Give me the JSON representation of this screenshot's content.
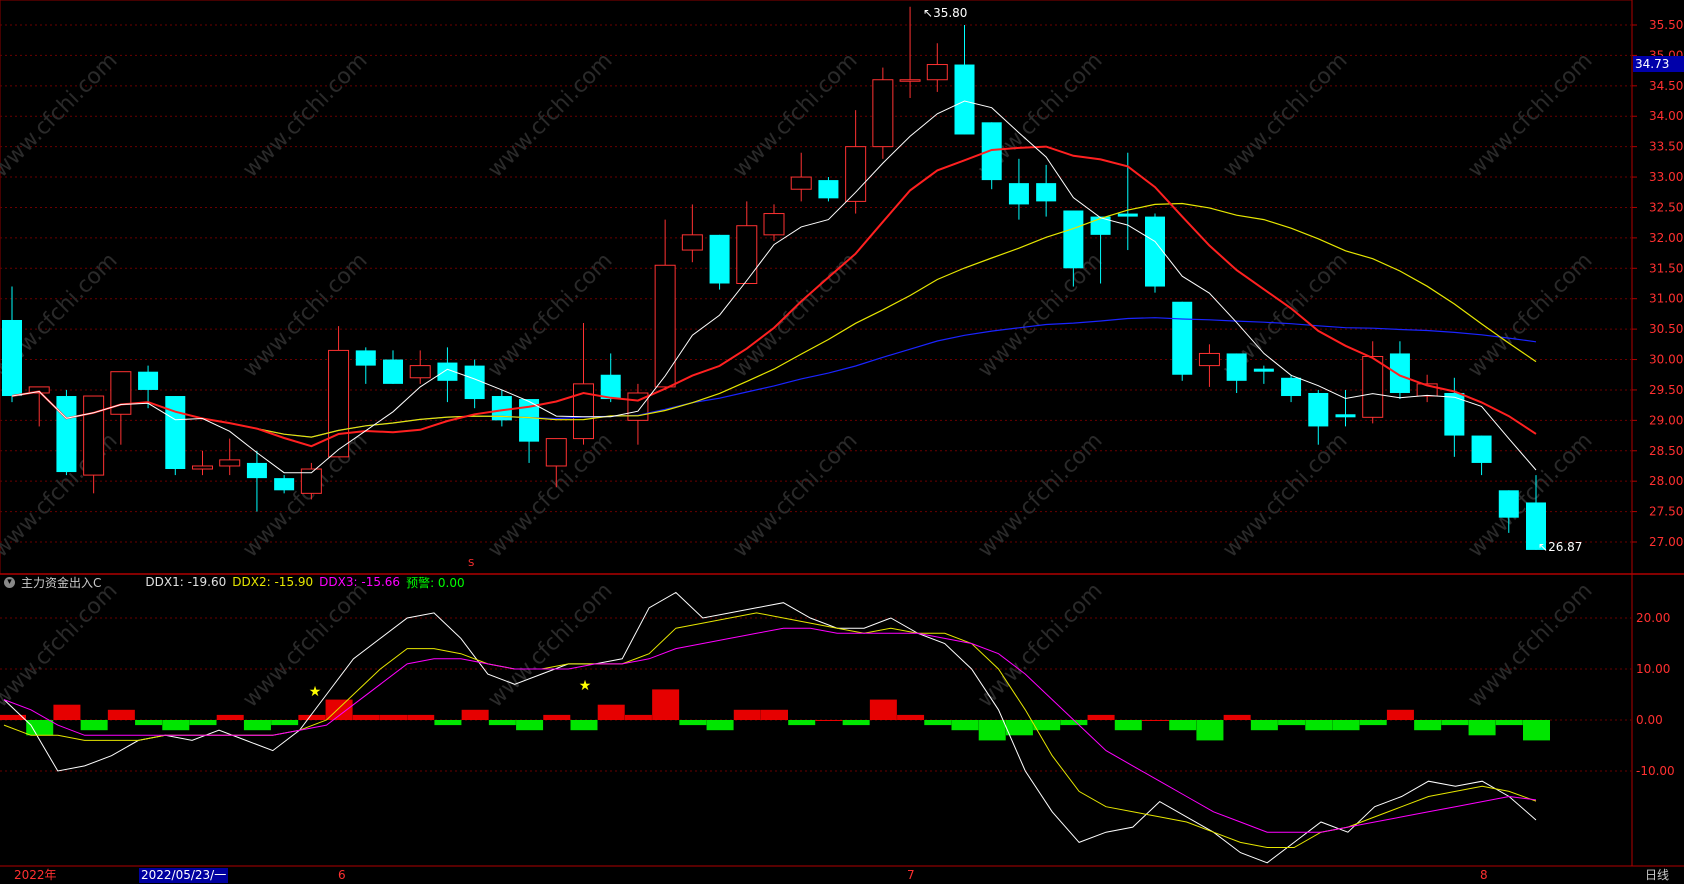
{
  "main_chart": {
    "price_ticks": [
      "35.50",
      "35.00",
      "34.50",
      "34.00",
      "33.50",
      "33.00",
      "32.50",
      "32.00",
      "31.50",
      "31.00",
      "30.50",
      "30.00",
      "29.50",
      "29.00",
      "28.50",
      "28.00",
      "27.50",
      "27.00"
    ],
    "current_price": "34.73",
    "high_label": "35.80",
    "low_label": "26.87",
    "dividend_mark": "S",
    "colors": {
      "up": "#ff3232",
      "down": "#00ffff",
      "ma5": "#ffffff",
      "ma10": "#ff2020",
      "ma20": "#e6e600",
      "ma60": "#1a24ff",
      "grid": "#8b0000"
    }
  },
  "indicator": {
    "name": "主力资金出入C",
    "ddx1_label": "DDX1: -19.60",
    "ddx2_label": "DDX2: -15.90",
    "ddx3_label": "DDX3: -15.66",
    "warn_label": "预警: 0.00",
    "y_ticks": [
      "20.00",
      "10.00",
      "0.00",
      "-10.00"
    ],
    "colors": {
      "ddx1": "#ffffff",
      "ddx2": "#e6e600",
      "ddx3": "#ff00ff",
      "warn": "#00ff00",
      "bar_pos": "#ff0000",
      "bar_neg": "#00ff00"
    }
  },
  "time_axis": {
    "year": "2022年",
    "cursor_date": "2022/05/23/一",
    "month_6": "6",
    "month_7": "7",
    "month_8": "8",
    "period": "日线"
  },
  "watermark": "www.cfchi.com",
  "chart_data": [
    {
      "type": "candlestick",
      "title": "",
      "ylim": [
        26.6,
        35.9
      ],
      "x": [
        "d1",
        "d2",
        "d3",
        "d4",
        "d5",
        "d6",
        "d7",
        "d8",
        "d9",
        "d10",
        "d11",
        "d12",
        "d13",
        "d14",
        "d15",
        "d16",
        "d17",
        "d18",
        "d19",
        "d20",
        "d21",
        "d22",
        "d23",
        "d24",
        "d25",
        "d26",
        "d27",
        "d28",
        "d29",
        "d30",
        "d31",
        "d32",
        "d33",
        "d34",
        "d35",
        "d36",
        "d37",
        "d38",
        "d39",
        "d40",
        "d41",
        "d42",
        "d43",
        "d44",
        "d45",
        "d46",
        "d47",
        "d48",
        "d49",
        "d50",
        "d51",
        "d52",
        "d53",
        "d54",
        "d55",
        "d56"
      ],
      "candles": [
        [
          30.65,
          31.2,
          29.3,
          29.4
        ],
        [
          29.45,
          29.55,
          28.9,
          29.55
        ],
        [
          29.4,
          29.5,
          28.1,
          28.15
        ],
        [
          28.1,
          29.4,
          27.8,
          29.4
        ],
        [
          29.1,
          29.8,
          28.6,
          29.8
        ],
        [
          29.8,
          29.9,
          29.2,
          29.5
        ],
        [
          29.4,
          29.4,
          28.1,
          28.2
        ],
        [
          28.2,
          28.5,
          28.1,
          28.25
        ],
        [
          28.25,
          28.7,
          28.1,
          28.35
        ],
        [
          28.3,
          28.5,
          27.5,
          28.05
        ],
        [
          28.05,
          28.1,
          27.8,
          27.85
        ],
        [
          27.8,
          28.3,
          27.7,
          28.2
        ],
        [
          28.4,
          30.55,
          28.4,
          30.15
        ],
        [
          30.15,
          30.2,
          29.6,
          29.9
        ],
        [
          30.0,
          30.15,
          29.6,
          29.6
        ],
        [
          29.7,
          30.15,
          29.6,
          29.9
        ],
        [
          29.95,
          30.2,
          29.3,
          29.65
        ],
        [
          29.9,
          30.0,
          29.2,
          29.35
        ],
        [
          29.4,
          29.5,
          28.9,
          29.0
        ],
        [
          29.35,
          29.35,
          28.3,
          28.65
        ],
        [
          28.25,
          28.7,
          27.9,
          28.7
        ],
        [
          28.7,
          30.6,
          28.6,
          29.6
        ],
        [
          29.75,
          30.1,
          29.3,
          29.35
        ],
        [
          29.0,
          29.6,
          28.6,
          29.45
        ],
        [
          29.55,
          32.3,
          29.5,
          31.55
        ],
        [
          31.8,
          32.55,
          31.6,
          32.05
        ],
        [
          32.05,
          32.05,
          31.15,
          31.25
        ],
        [
          31.25,
          32.6,
          31.25,
          32.2
        ],
        [
          32.05,
          32.55,
          31.95,
          32.4
        ],
        [
          32.8,
          33.4,
          32.6,
          33.0
        ],
        [
          32.95,
          33.0,
          32.6,
          32.65
        ],
        [
          32.6,
          34.1,
          32.4,
          33.5
        ],
        [
          33.5,
          34.8,
          33.3,
          34.6
        ],
        [
          34.6,
          35.8,
          34.3,
          34.6
        ],
        [
          34.6,
          35.2,
          34.4,
          34.85
        ],
        [
          34.85,
          35.5,
          33.7,
          33.7
        ],
        [
          33.9,
          33.9,
          32.8,
          32.95
        ],
        [
          32.9,
          33.3,
          32.3,
          32.55
        ],
        [
          32.9,
          33.2,
          32.35,
          32.6
        ],
        [
          32.45,
          32.45,
          31.2,
          31.5
        ],
        [
          32.35,
          32.35,
          31.25,
          32.05
        ],
        [
          32.4,
          33.4,
          31.8,
          32.35
        ],
        [
          32.35,
          32.4,
          31.1,
          31.2
        ],
        [
          30.95,
          30.95,
          29.65,
          29.75
        ],
        [
          29.9,
          30.25,
          29.55,
          30.1
        ],
        [
          30.1,
          30.1,
          29.45,
          29.65
        ],
        [
          29.85,
          29.9,
          29.6,
          29.8
        ],
        [
          29.7,
          29.75,
          29.3,
          29.4
        ],
        [
          29.45,
          29.5,
          28.6,
          28.9
        ],
        [
          29.1,
          29.5,
          28.9,
          29.05
        ],
        [
          29.05,
          30.3,
          28.95,
          30.05
        ],
        [
          30.1,
          30.3,
          29.35,
          29.45
        ],
        [
          29.4,
          29.75,
          29.3,
          29.6
        ],
        [
          29.45,
          29.7,
          28.4,
          28.75
        ],
        [
          28.75,
          28.75,
          28.1,
          28.3
        ],
        [
          27.85,
          27.85,
          27.15,
          27.4
        ],
        [
          27.65,
          28.1,
          26.87,
          26.87
        ]
      ]
    },
    {
      "type": "line",
      "title": "",
      "ylim": [
        -28,
        28
      ],
      "series": [
        {
          "name": "DDX1",
          "values": [
            4,
            -1,
            -10,
            -9,
            -7,
            -4,
            -3,
            -4,
            -2,
            -4,
            -6,
            -2,
            5,
            12,
            16,
            20,
            21,
            16,
            9,
            7,
            9,
            11,
            11,
            12,
            22,
            25,
            20,
            21,
            22,
            23,
            20,
            18,
            18,
            20,
            17,
            15,
            10,
            2,
            -10,
            -18,
            -24,
            -22,
            -21,
            -16,
            -19,
            -22,
            -26,
            -28,
            -24,
            -20,
            -22,
            -17,
            -15,
            -12,
            -13,
            -12,
            -15,
            -19.6
          ]
        },
        {
          "name": "DDX2",
          "values": [
            -1,
            -3,
            -3,
            -4,
            -4,
            -4,
            -3,
            -3,
            -3,
            -3,
            -3,
            -2,
            0,
            5,
            10,
            14,
            14,
            13,
            11,
            10,
            10,
            11,
            11,
            11,
            13,
            18,
            19,
            20,
            21,
            20,
            19,
            18,
            17,
            18,
            17,
            17,
            15,
            10,
            2,
            -7,
            -14,
            -17,
            -18,
            -19,
            -20,
            -22,
            -24,
            -25,
            -25,
            -22,
            -21,
            -19,
            -17,
            -15,
            -14,
            -13,
            -14,
            -15.9
          ]
        },
        {
          "name": "DDX3",
          "values": [
            4,
            2,
            -1,
            -3,
            -3,
            -3,
            -3,
            -3,
            -3,
            -3,
            -3,
            -2,
            -1,
            3,
            7,
            11,
            12,
            12,
            11,
            10,
            10,
            10,
            11,
            11,
            12,
            14,
            15,
            16,
            17,
            18,
            18,
            17,
            17,
            17,
            17,
            16,
            15,
            13,
            9,
            4,
            -1,
            -6,
            -9,
            -12,
            -15,
            -18,
            -20,
            -22,
            -22,
            -22,
            -21,
            -20,
            -19,
            -18,
            -17,
            -16,
            -15,
            -15.66
          ]
        }
      ],
      "bars": [
        1,
        -3,
        3,
        -2,
        2,
        -1,
        -2,
        -1,
        1,
        -2,
        -1,
        1,
        4,
        1,
        1,
        1,
        -1,
        2,
        -1,
        -2,
        1,
        -2,
        3,
        1,
        6,
        -1,
        -2,
        2,
        2,
        -1,
        0,
        -1,
        4,
        1,
        -1,
        -2,
        -4,
        -3,
        -2,
        -1,
        1,
        -2,
        0,
        -2,
        -4,
        1,
        -2,
        -1,
        -2,
        -2,
        -1,
        2,
        -2,
        -1,
        -3,
        -1,
        -4
      ]
    }
  ]
}
